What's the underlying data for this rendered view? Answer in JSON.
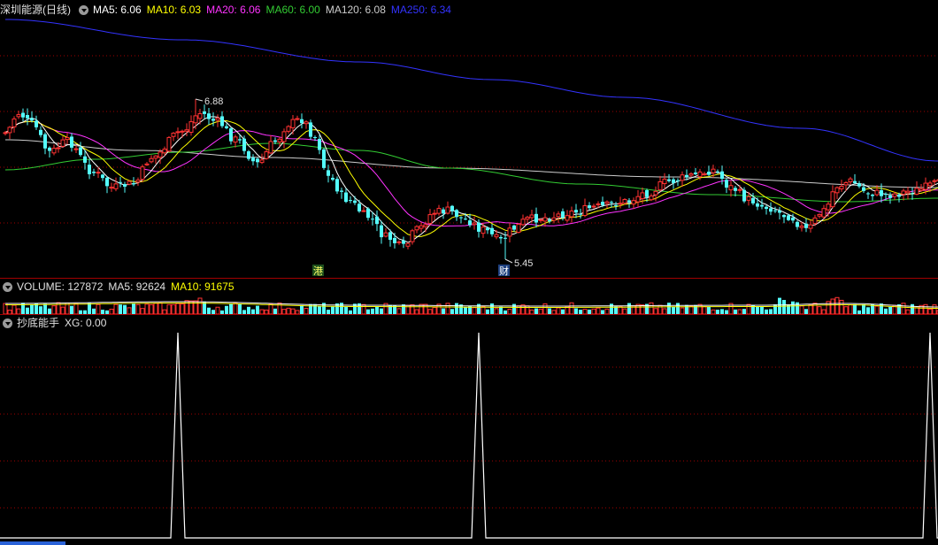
{
  "price_panel": {
    "title": "深圳能源(日线)",
    "ma_values": [
      {
        "label": "MA5: 6.06",
        "color": "#ffffff"
      },
      {
        "label": "MA10: 6.03",
        "color": "#ffff00"
      },
      {
        "label": "MA20: 6.06",
        "color": "#ff33ff"
      },
      {
        "label": "MA60: 6.00",
        "color": "#33cc33"
      },
      {
        "label": "MA120: 6.08",
        "color": "#cccccc"
      },
      {
        "label": "MA250: 6.34",
        "color": "#3333ff"
      }
    ],
    "high_label": "6.88",
    "low_label": "5.45",
    "tag_gang": "港",
    "tag_cai": "财"
  },
  "volume_panel": {
    "legend_volume": "VOLUME: 127872",
    "legend_ma5": "MA5: 92624",
    "legend_ma10": "MA10: 91675"
  },
  "indicator_panel": {
    "legend_name": "抄底能手",
    "legend_xg": "XG: 0.00"
  },
  "colors": {
    "up": "#ff3232",
    "down": "#54fcfc",
    "grid": "#a00000",
    "ma5": "#ffffff",
    "ma10": "#ffff00",
    "ma20": "#ff33ff",
    "ma60": "#33cc33",
    "ma120": "#cccccc",
    "ma250": "#3333ff"
  },
  "signal_days": [
    39,
    107,
    209
  ]
}
